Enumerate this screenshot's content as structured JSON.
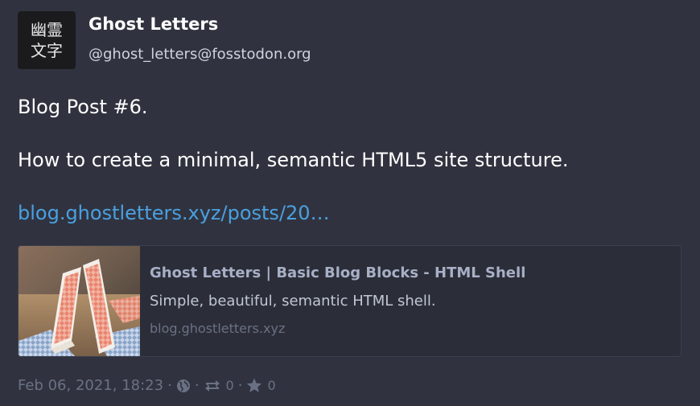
{
  "account": {
    "avatar_text_line1": "幽霊",
    "avatar_text_line2": "文字",
    "display_name": "Ghost Letters",
    "handle": "@ghost_letters@fosstodon.org"
  },
  "status": {
    "line1": "Blog Post #6.",
    "line2": "How to create a minimal, semantic HTML5 site structure.",
    "link_text": "blog.ghostletters.xyz/posts/20…"
  },
  "card": {
    "title": "Ghost Letters | Basic Blog Blocks - HTML Shell",
    "description": "Simple, beautiful, semantic HTML shell.",
    "host": "blog.ghostletters.xyz"
  },
  "meta": {
    "timestamp": "Feb 06, 2021, 18:23",
    "visibility_icon": "globe-icon",
    "reblog_count": "0",
    "favourite_count": "0"
  },
  "colors": {
    "background": "#30333f",
    "link": "#4aa0e0",
    "muted": "#6b7184"
  }
}
